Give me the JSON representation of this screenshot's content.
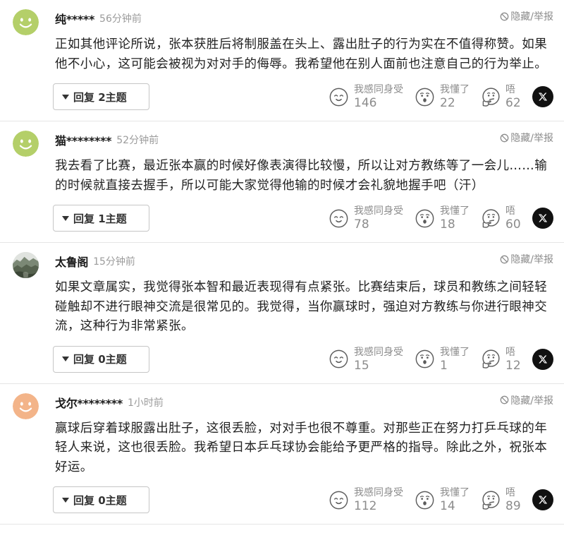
{
  "comments": [
    {
      "avatar": {
        "icon": "smiley-avatar-icon",
        "color": "#b4cf69"
      },
      "username": "纯*****",
      "time": "56分钟前",
      "hide_report": "隐藏/举报",
      "text": "正如其他评论所说，张本获胜后将制服盖在头上、露出肚子的行为实在不值得称赞。如果他不小心，这可能会被视为对对手的侮辱。我希望他在别人面前也注意自己的行为举止。",
      "reply": "回复 2主题",
      "reactions": [
        {
          "icon": "empathy-face-icon",
          "label": "我感同身受",
          "count": 146
        },
        {
          "icon": "understood-face-icon",
          "label": "我懂了",
          "count": 22
        },
        {
          "icon": "thinking-face-icon",
          "label": "唔",
          "count": 62
        }
      ],
      "share_icon": "x-logo-icon"
    },
    {
      "avatar": {
        "icon": "smiley-avatar-icon",
        "color": "#b4cf69"
      },
      "username": "猫********",
      "time": "52分钟前",
      "hide_report": "隐藏/举报",
      "text": "我去看了比赛，最近张本赢的时候好像表演得比较慢，所以让对方教练等了一会儿……输的时候就直接去握手，所以可能大家觉得他输的时候才会礼貌地握手吧（汗）",
      "reply": "回复 1主题",
      "reactions": [
        {
          "icon": "empathy-face-icon",
          "label": "我感同身受",
          "count": 78
        },
        {
          "icon": "understood-face-icon",
          "label": "我懂了",
          "count": 18
        },
        {
          "icon": "thinking-face-icon",
          "label": "唔",
          "count": 60
        }
      ],
      "share_icon": "x-logo-icon"
    },
    {
      "avatar": {
        "icon": "photo-avatar-icon"
      },
      "username": "太鲁阁",
      "time": "15分钟前",
      "hide_report": "隐藏/举报",
      "text": "如果文章属实，我觉得张本智和最近表现得有点紧张。比赛结束后，球员和教练之间轻轻碰触却不进行眼神交流是很常见的。我觉得，当你赢球时，强迫对方教练与你进行眼神交流，这种行为非常紧张。",
      "reply": "回复 0主题",
      "reactions": [
        {
          "icon": "empathy-face-icon",
          "label": "我感同身受",
          "count": 15
        },
        {
          "icon": "understood-face-icon",
          "label": "我懂了",
          "count": 1
        },
        {
          "icon": "thinking-face-icon",
          "label": "唔",
          "count": 12
        }
      ],
      "share_icon": "x-logo-icon"
    },
    {
      "avatar": {
        "icon": "smiley-avatar-icon",
        "color": "#f3b489"
      },
      "username": "戈尔********",
      "time": "1小时前",
      "hide_report": "隐藏/举报",
      "text": "赢球后穿着球服露出肚子，这很丢脸，对对手也很不尊重。对那些正在努力打乒乓球的年轻人来说，这也很丢脸。我希望日本乒乓球协会能给予更严格的指导。除此之外，祝张本好运。",
      "reply": "回复 0主题",
      "reactions": [
        {
          "icon": "empathy-face-icon",
          "label": "我感同身受",
          "count": 112
        },
        {
          "icon": "understood-face-icon",
          "label": "我懂了",
          "count": 14
        },
        {
          "icon": "thinking-face-icon",
          "label": "唔",
          "count": 89
        }
      ],
      "share_icon": "x-logo-icon"
    }
  ]
}
